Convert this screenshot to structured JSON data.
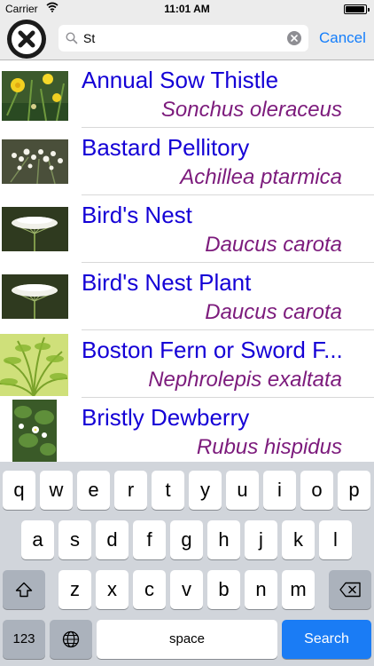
{
  "status_bar": {
    "carrier": "Carrier",
    "time": "11:01 AM",
    "battery_level": 0.95
  },
  "search": {
    "query": "St",
    "cancel_label": "Cancel"
  },
  "results": [
    {
      "common_name": "Annual Sow Thistle",
      "latin_name": "Sonchus oleraceus"
    },
    {
      "common_name": "Bastard Pellitory",
      "latin_name": "Achillea ptarmica"
    },
    {
      "common_name": "Bird's Nest",
      "latin_name": "Daucus carota"
    },
    {
      "common_name": "Bird's Nest Plant",
      "latin_name": "Daucus carota"
    },
    {
      "common_name": "Boston Fern or Sword F...",
      "latin_name": "Nephrolepis exaltata"
    },
    {
      "common_name": "Bristly Dewberry",
      "latin_name": "Rubus hispidus"
    }
  ],
  "keyboard": {
    "row1": [
      "q",
      "w",
      "e",
      "r",
      "t",
      "y",
      "u",
      "i",
      "o",
      "p"
    ],
    "row2": [
      "a",
      "s",
      "d",
      "f",
      "g",
      "h",
      "j",
      "k",
      "l"
    ],
    "row3": [
      "z",
      "x",
      "c",
      "v",
      "b",
      "n",
      "m"
    ],
    "numbers_label": "123",
    "space_label": "space",
    "search_label": "Search"
  },
  "colors": {
    "link_blue": "#147efb",
    "name_blue": "#1400d6",
    "latin_purple": "#7c1b7c",
    "search_key": "#1a7cf5"
  },
  "icons": [
    "wifi-icon",
    "battery-icon",
    "close-icon",
    "search-icon",
    "clear-icon",
    "shift-icon",
    "backspace-icon",
    "globe-icon"
  ]
}
